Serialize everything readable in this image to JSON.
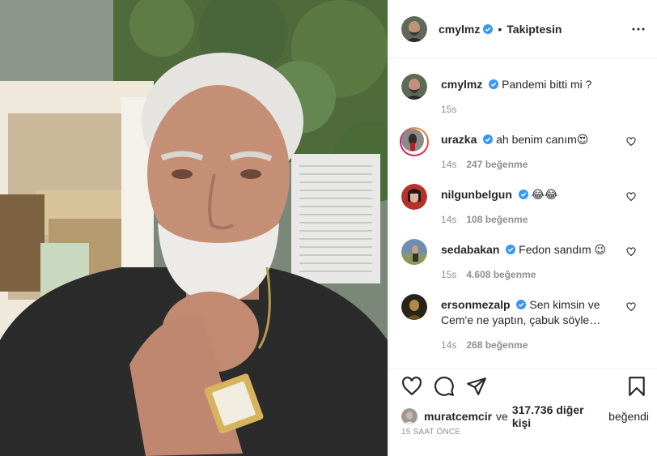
{
  "post": {
    "author": "cmylmz",
    "follow_status": "Takiptesin",
    "separator": "•"
  },
  "caption": {
    "user": "cmylmz",
    "text": "Pandemi bitti mi ?",
    "time": "15s"
  },
  "comments": [
    {
      "user": "urazka",
      "text": "ah benim canım😍",
      "time": "14s",
      "likes": "247 beğenme",
      "verified": true
    },
    {
      "user": "nilgunbelgun",
      "text": "😂😂",
      "time": "14s",
      "likes": "108 beğenme",
      "verified": true
    },
    {
      "user": "sedabakan",
      "text": "Fedon sandım 😉",
      "time": "15s",
      "likes": "4.608 beğenme",
      "verified": true
    },
    {
      "user": "ersonmezalp",
      "text": "Sen kimsin ve Cem'e ne yaptın, çabuk söyle…",
      "time": "14s",
      "likes": "268 beğenme",
      "verified": true
    }
  ],
  "likes_summary": {
    "first_user": "muratcemcir",
    "connector": "ve",
    "others": "317.736 diğer kişi",
    "suffix": "beğendi"
  },
  "posted_ago": "15 SAAT ÖNCE",
  "icons": [
    "more-icon",
    "heart-icon",
    "comment-icon",
    "share-icon",
    "bookmark-icon",
    "verified-icon"
  ],
  "colors": {
    "verified": "#3897f0",
    "muted": "#8e8e8e",
    "text": "#262626",
    "border": "#efefef"
  }
}
